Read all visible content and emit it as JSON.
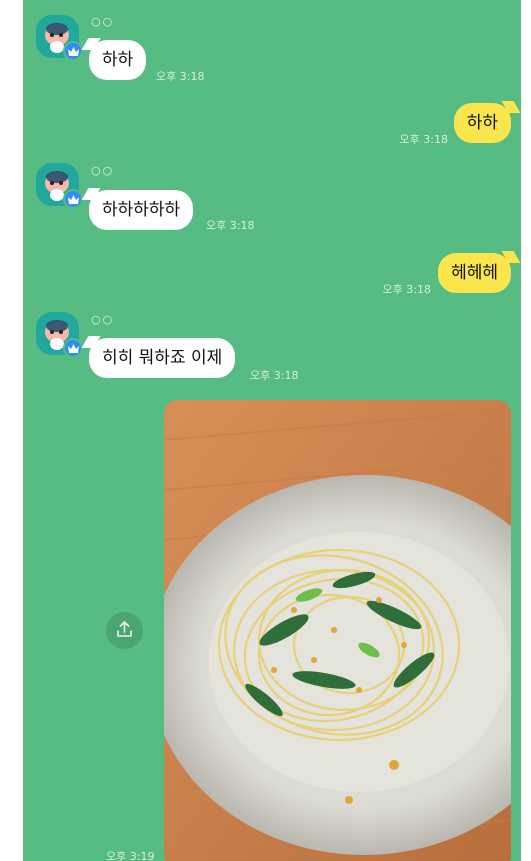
{
  "colors": {
    "chat_background": "#56bc83",
    "incoming_bubble": "#ffffff",
    "outgoing_bubble": "#fbe54c",
    "avatar_background": "#1fa89b",
    "badge": "#2e8ef5"
  },
  "sender_name": "○○",
  "messages": [
    {
      "direction": "incoming",
      "text": "하하",
      "time": "오후 3:18"
    },
    {
      "direction": "outgoing",
      "text": "하하",
      "time": "오후 3:18"
    },
    {
      "direction": "incoming",
      "text": "하하하하하",
      "time": "오후 3:18"
    },
    {
      "direction": "outgoing",
      "text": "헤헤헤",
      "time": "오후 3:18"
    },
    {
      "direction": "incoming",
      "text": "히히 뭐하죠 이제",
      "time": "오후 3:18"
    },
    {
      "direction": "incoming",
      "type": "photo",
      "time": "오후 3:19",
      "icon": "share-icon"
    }
  ]
}
